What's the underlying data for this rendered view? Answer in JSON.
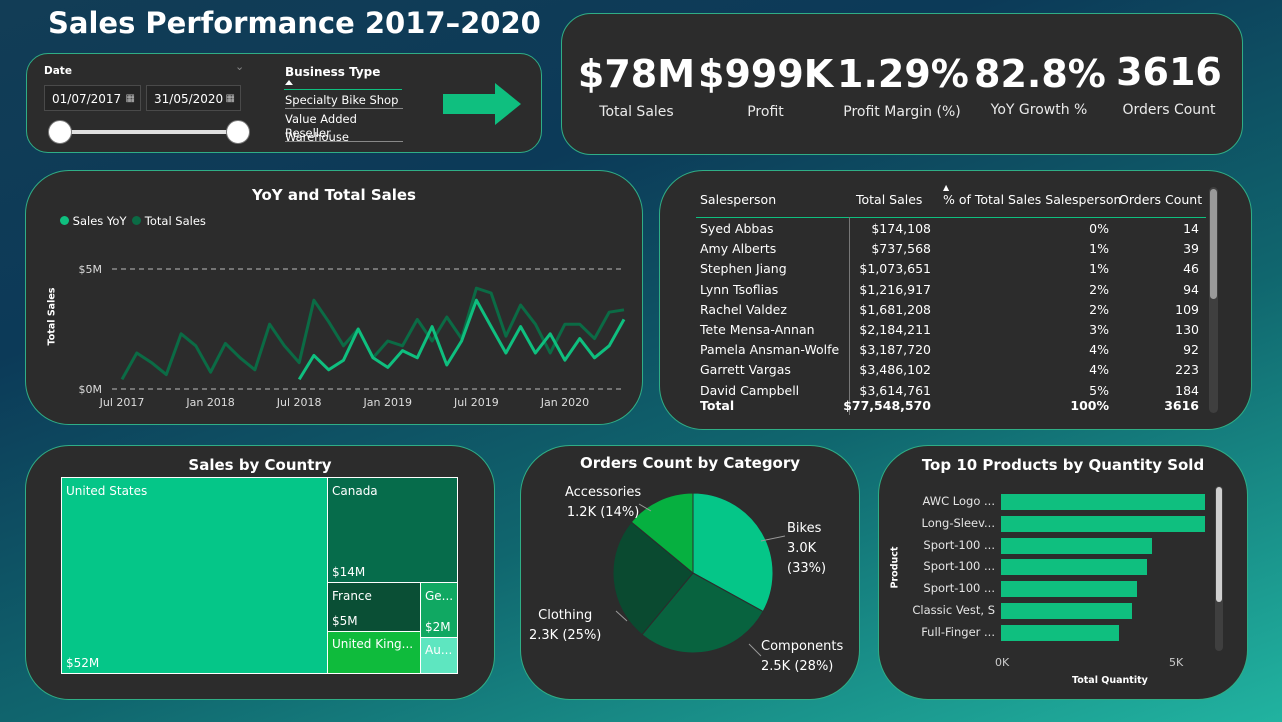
{
  "dashboard": {
    "title": "Sales Performance 2017–2020"
  },
  "filters": {
    "date_label": "Date",
    "date_from": "01/07/2017",
    "date_to": "31/05/2020",
    "business_type_label": "Business Type",
    "business_types": [
      "Specialty Bike Shop",
      "Value Added Reseller",
      "Warehouse"
    ]
  },
  "kpis": [
    {
      "value": "$78M",
      "label": "Total Sales"
    },
    {
      "value": "$999K",
      "label": "Profit"
    },
    {
      "value": "1.29%",
      "label": "Profit Margin (%)"
    },
    {
      "value": "82.8%",
      "label": "YoY Growth %"
    },
    {
      "value": "3616",
      "label": "Orders Count"
    }
  ],
  "colors": {
    "accent": "#0fbf7f",
    "dark_green": "#0b5e3c",
    "panel": "#2c2c2c",
    "border": "#2fae86"
  },
  "chart_data": [
    {
      "type": "line",
      "title": "YoY and Total Sales",
      "ylabel": "Total Sales",
      "xlabel": "",
      "ylim": [
        0,
        5000000
      ],
      "y_ticks": [
        "$0M",
        "$5M"
      ],
      "x_ticks": [
        "Jul 2017",
        "Jan 2018",
        "Jul 2018",
        "Jan 2019",
        "Jul 2019",
        "Jan 2020"
      ],
      "legend": "top-left",
      "x": [
        "2017-07",
        "2017-08",
        "2017-09",
        "2017-10",
        "2017-11",
        "2017-12",
        "2018-01",
        "2018-02",
        "2018-03",
        "2018-04",
        "2018-05",
        "2018-06",
        "2018-07",
        "2018-08",
        "2018-09",
        "2018-10",
        "2018-11",
        "2018-12",
        "2019-01",
        "2019-02",
        "2019-03",
        "2019-04",
        "2019-05",
        "2019-06",
        "2019-07",
        "2019-08",
        "2019-09",
        "2019-10",
        "2019-11",
        "2019-12",
        "2020-01",
        "2020-02",
        "2020-03",
        "2020-04",
        "2020-05"
      ],
      "series": [
        {
          "name": "Sales YoY",
          "color": "#0fbf7f",
          "values": [
            null,
            null,
            null,
            null,
            null,
            null,
            null,
            null,
            null,
            null,
            null,
            null,
            0.4,
            1.4,
            0.8,
            1.2,
            2.5,
            1.3,
            0.9,
            1.6,
            1.3,
            2.6,
            1.0,
            2.0,
            3.7,
            2.6,
            1.5,
            2.6,
            1.5,
            2.3,
            1.2,
            2.1,
            1.3,
            1.8,
            2.9
          ]
        },
        {
          "name": "Total Sales",
          "color": "#0b6b45",
          "values": [
            0.4,
            1.5,
            1.1,
            0.6,
            2.3,
            1.8,
            0.7,
            1.9,
            1.3,
            0.8,
            2.7,
            1.8,
            1.1,
            3.7,
            2.8,
            1.8,
            2.5,
            1.3,
            2.0,
            1.8,
            2.9,
            2.0,
            3.0,
            2.1,
            4.2,
            4.0,
            2.2,
            3.5,
            2.7,
            1.5,
            2.7,
            2.7,
            2.1,
            3.2,
            3.3
          ]
        }
      ]
    },
    {
      "type": "table",
      "columns": [
        "Salesperson",
        "Total Sales",
        "% of Total Sales Salesperson",
        "Orders Count"
      ],
      "rows": [
        [
          "Syed Abbas",
          "$174,108",
          "0%",
          "14"
        ],
        [
          "Amy Alberts",
          "$737,568",
          "1%",
          "39"
        ],
        [
          "Stephen Jiang",
          "$1,073,651",
          "1%",
          "46"
        ],
        [
          "Lynn Tsoflias",
          "$1,216,917",
          "2%",
          "94"
        ],
        [
          "Rachel Valdez",
          "$1,681,208",
          "2%",
          "109"
        ],
        [
          "Tete Mensa-Annan",
          "$2,184,211",
          "3%",
          "130"
        ],
        [
          "Pamela Ansman-Wolfe",
          "$3,187,720",
          "4%",
          "92"
        ],
        [
          "Garrett Vargas",
          "$3,486,102",
          "4%",
          "223"
        ],
        [
          "David Campbell",
          "$3,614,761",
          "5%",
          "184"
        ]
      ],
      "total": [
        "Total",
        "$77,548,570",
        "100%",
        "3616"
      ]
    },
    {
      "type": "treemap",
      "title": "Sales by Country",
      "cells": [
        {
          "name": "United States",
          "label": "$52M",
          "value": 52,
          "color": "#05c688"
        },
        {
          "name": "Canada",
          "label": "$14M",
          "value": 14,
          "color": "#066c4b"
        },
        {
          "name": "France",
          "label": "$5M",
          "value": 5,
          "color": "#0a4f35"
        },
        {
          "name": "United King...",
          "label": "",
          "value": 4,
          "color": "#0fbb3c"
        },
        {
          "name": "Ge...",
          "label": "$2M",
          "value": 2,
          "color": "#10a862"
        },
        {
          "name": "Au...",
          "label": "",
          "value": 1.5,
          "color": "#5ee6c0"
        }
      ]
    },
    {
      "type": "pie",
      "title": "Orders Count by Category",
      "slices": [
        {
          "name": "Bikes",
          "label": "3.0K (33%)",
          "value": 33,
          "color": "#05c688"
        },
        {
          "name": "Components",
          "label": "2.5K (28%)",
          "value": 28,
          "color": "#08633f"
        },
        {
          "name": "Clothing",
          "label": "2.3K (25%)",
          "value": 25,
          "color": "#0a4a30"
        },
        {
          "name": "Accessories",
          "label": "1.2K (14%)",
          "value": 14,
          "color": "#06b040"
        }
      ]
    },
    {
      "type": "bar",
      "orientation": "horizontal",
      "title": "Top 10 Products by Quantity Sold",
      "ylabel": "Product",
      "xlabel": "Total Quantity",
      "x_ticks": [
        "0K",
        "5K"
      ],
      "xlim": [
        0,
        5600
      ],
      "categories": [
        "AWC Logo ...",
        "Long-Sleev...",
        "Sport-100 ...",
        "Sport-100 ...",
        "Sport-100 ...",
        "Classic Vest, S",
        "Full-Finger ..."
      ],
      "values": [
        5850,
        5850,
        4350,
        4200,
        3900,
        3750,
        3400
      ]
    }
  ]
}
